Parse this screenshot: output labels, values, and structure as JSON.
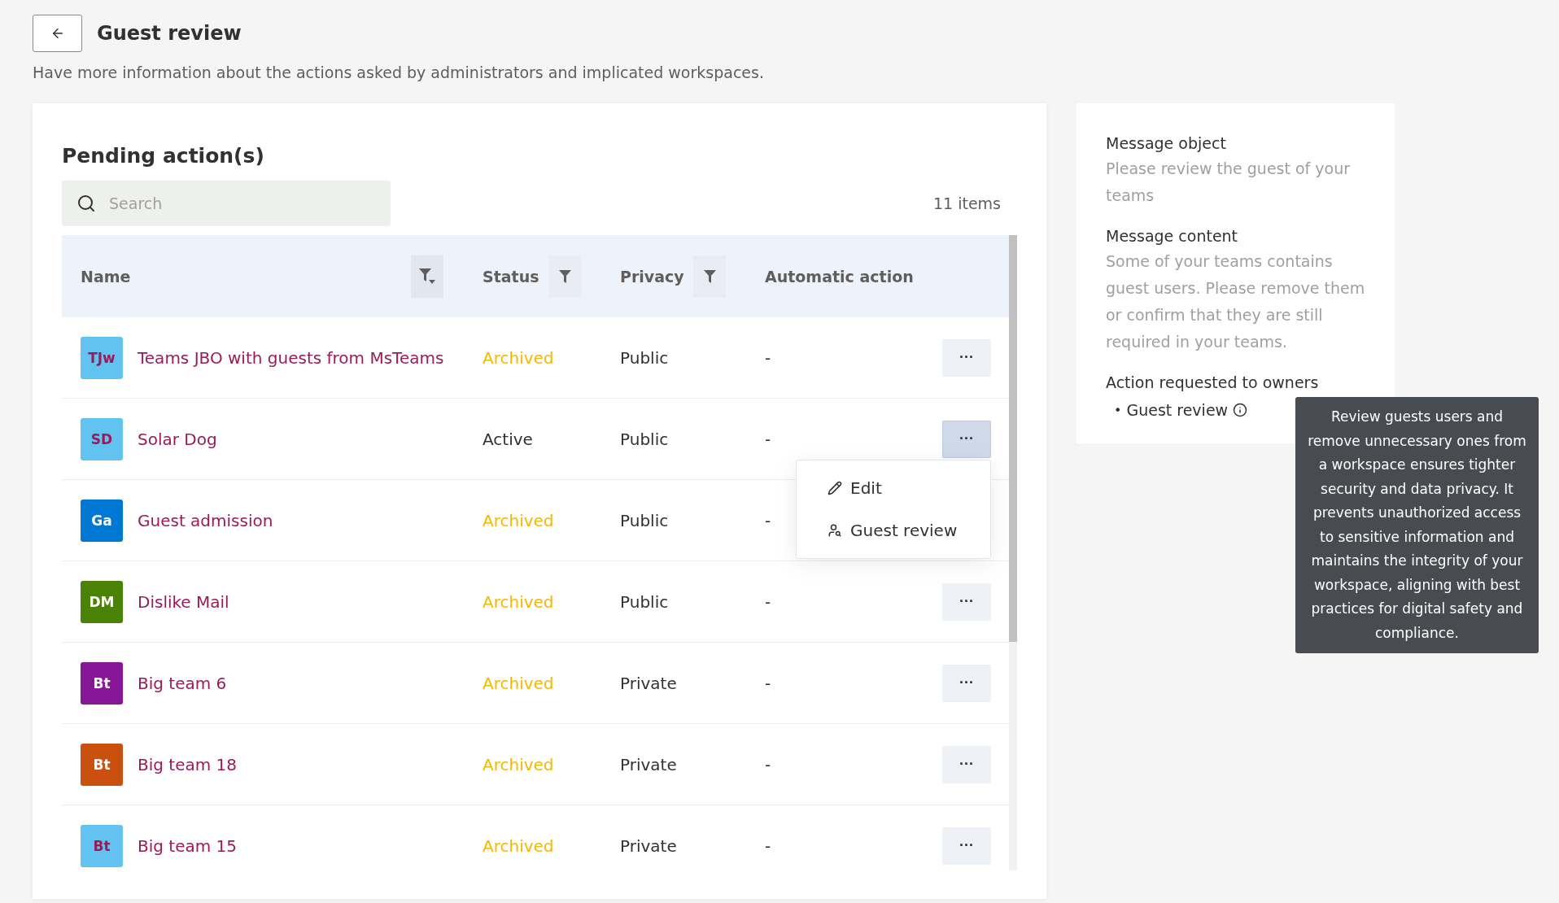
{
  "page": {
    "title": "Guest review",
    "subtitle": "Have more information about the actions asked by administrators and implicated workspaces."
  },
  "pending": {
    "title": "Pending action(s)",
    "search": {
      "placeholder": "Search"
    },
    "count": "11 items",
    "columns": [
      {
        "label": "Name",
        "filter": true,
        "filter_active": true
      },
      {
        "label": "Status",
        "filter": true,
        "filter_active": false
      },
      {
        "label": "Privacy",
        "filter": true,
        "filter_active": false
      },
      {
        "label": "Automatic action"
      }
    ],
    "rows": [
      {
        "initials": "TJw",
        "color": "#62c3f0",
        "name": "Teams JBO with guests from MsTeams",
        "status": {
          "label": "Archived",
          "color": "#f5b800"
        },
        "privacy": "Public",
        "action": "-",
        "more": "···",
        "menu_open": false
      },
      {
        "initials": "SD",
        "color": "#62c3f0",
        "name": "Solar Dog",
        "status": {
          "label": "Active",
          "color": "#323130"
        },
        "privacy": "Public",
        "action": "-",
        "more": "···",
        "menu_open": true
      },
      {
        "initials": "Ga",
        "color": "#0078d4",
        "name": "Guest admission",
        "status": {
          "label": "Archived",
          "color": "#f5b800"
        },
        "privacy": "Public",
        "action": "-",
        "menu_open": false
      },
      {
        "initials": "DM",
        "color": "#498205",
        "name": "Dislike Mail",
        "status": {
          "label": "Archived",
          "color": "#f5b800"
        },
        "privacy": "Public",
        "action": "-",
        "more": "···",
        "menu_open": false
      },
      {
        "initials": "Bt",
        "color": "#881798",
        "name": "Big team 6",
        "status": {
          "label": "Archived",
          "color": "#f5b800"
        },
        "privacy": "Private",
        "action": "-",
        "more": "···",
        "menu_open": false
      },
      {
        "initials": "Bt",
        "color": "#ca5010",
        "name": "Big team 18",
        "status": {
          "label": "Archived",
          "color": "#f5b800"
        },
        "privacy": "Private",
        "action": "-",
        "more": "···",
        "menu_open": false
      },
      {
        "initials": "Bt",
        "color": "#62c3f0",
        "name": "Big team 15",
        "status": {
          "label": "Archived",
          "color": "#f5b800"
        },
        "privacy": "Private",
        "action": "-",
        "more": "···",
        "menu_open": false
      }
    ],
    "row_menu": [
      {
        "kind": "edit",
        "label": "Edit"
      },
      {
        "kind": "review",
        "label": "Guest review"
      }
    ]
  },
  "message": {
    "sections": [
      {
        "heading": "Message object",
        "text": "Please review the guest of your teams"
      },
      {
        "heading": "Message content",
        "text": "Some of your teams contains guest users. Please remove them or confirm that they are still required in your teams."
      }
    ],
    "actions_heading": "Action requested to owners",
    "actions": [
      {
        "label": "Guest review",
        "bullet": "•"
      }
    ]
  },
  "tooltip": {
    "text": "Review guests users and remove unnecessary ones from a workspace ensures tighter security and data privacy. It prevents unauthorized access to sensitive information and maintains the integrity of your workspace, aligning with best practices for digital safety and compliance."
  }
}
